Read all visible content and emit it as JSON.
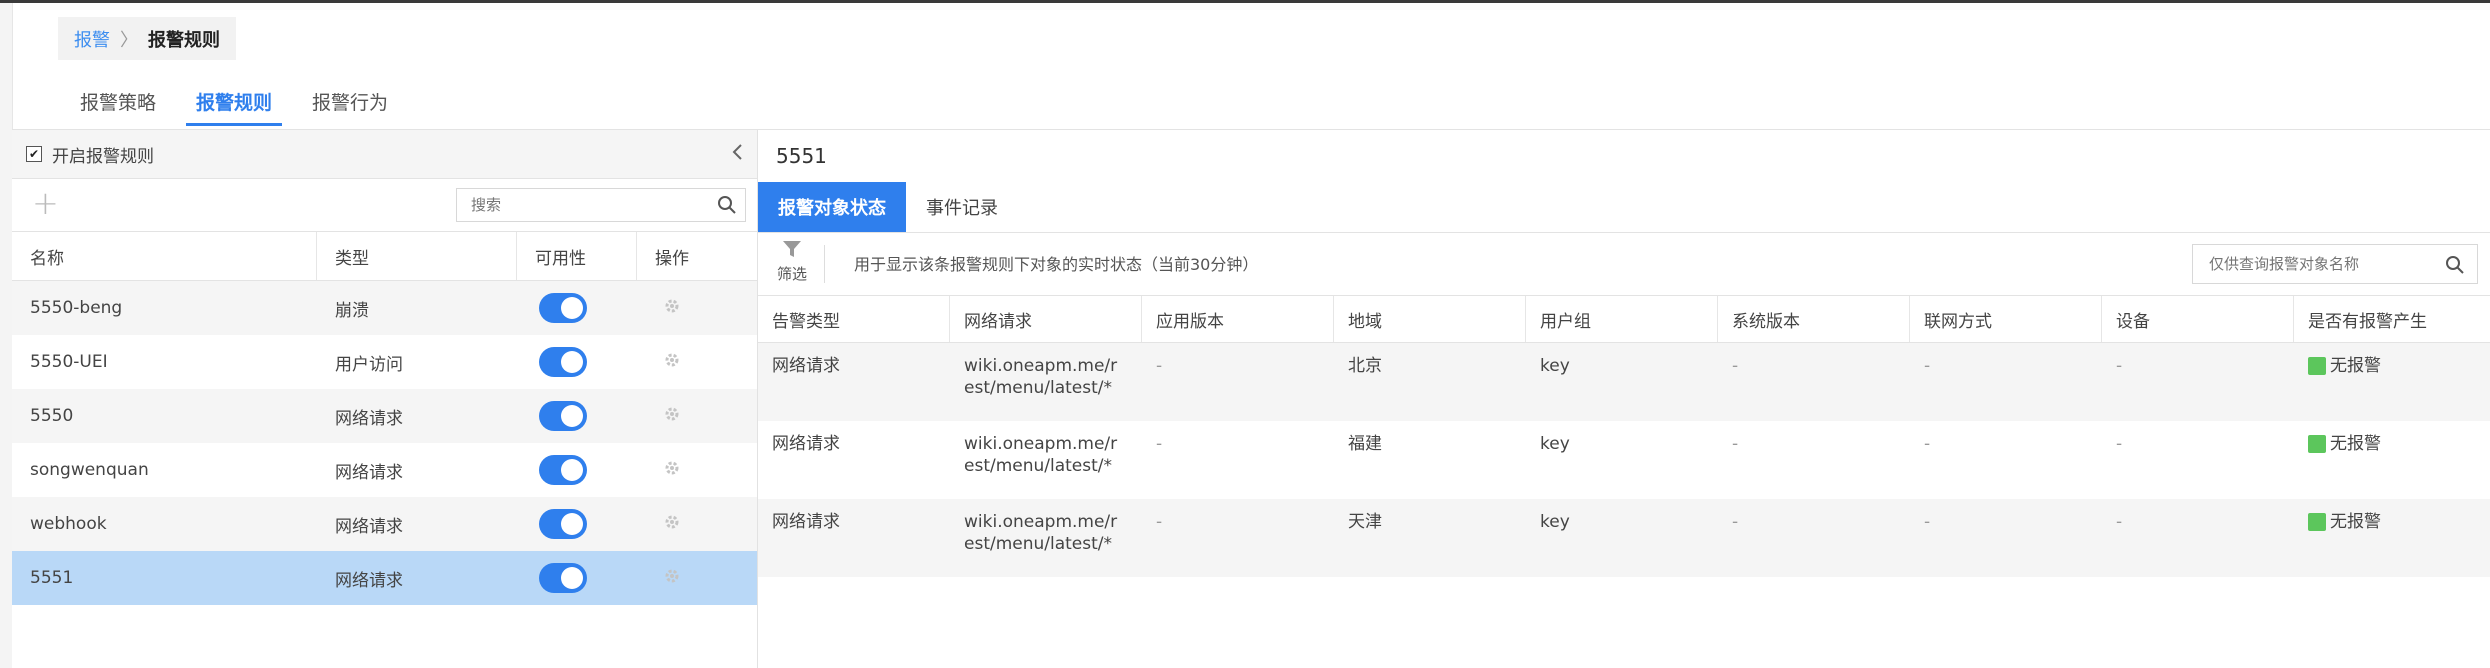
{
  "breadcrumb": {
    "parent": "报警",
    "separator": "〉",
    "current": "报警规则"
  },
  "top_tabs": [
    {
      "label": "报警策略",
      "active": false
    },
    {
      "label": "报警规则",
      "active": true
    },
    {
      "label": "报警行为",
      "active": false
    }
  ],
  "left_panel": {
    "enable_label": "开启报警规则",
    "enable_checked": true,
    "search_placeholder": "搜索",
    "columns": [
      "名称",
      "类型",
      "可用性",
      "操作"
    ],
    "rows": [
      {
        "name": "5550-beng",
        "type": "崩溃",
        "enabled": true
      },
      {
        "name": "5550-UEI",
        "type": "用户访问",
        "enabled": true
      },
      {
        "name": "5550",
        "type": "网络请求",
        "enabled": true
      },
      {
        "name": "songwenquan",
        "type": "网络请求",
        "enabled": true
      },
      {
        "name": "webhook",
        "type": "网络请求",
        "enabled": true
      },
      {
        "name": "5551",
        "type": "网络请求",
        "enabled": true,
        "selected": true
      }
    ]
  },
  "right_panel": {
    "title": "5551",
    "tabs": [
      {
        "label": "报警对象状态",
        "active": true
      },
      {
        "label": "事件记录",
        "active": false
      }
    ],
    "filter_label": "筛选",
    "filter_desc": "用于显示该条报警规则下对象的实时状态（当前30分钟）",
    "search_placeholder": "仅供查询报警对象名称",
    "columns": [
      "告警类型",
      "网络请求",
      "应用版本",
      "地域",
      "用户组",
      "系统版本",
      "联网方式",
      "设备",
      "是否有报警产生"
    ],
    "rows": [
      {
        "type": "网络请求",
        "url1": "wiki.oneapm.me/r",
        "url2": "est/menu/latest/*",
        "app_version": "-",
        "region": "北京",
        "user_group": "key",
        "os_version": "-",
        "network": "-",
        "device": "-",
        "alarm": "无报警"
      },
      {
        "type": "网络请求",
        "url1": "wiki.oneapm.me/r",
        "url2": "est/menu/latest/*",
        "app_version": "-",
        "region": "福建",
        "user_group": "key",
        "os_version": "-",
        "network": "-",
        "device": "-",
        "alarm": "无报警"
      },
      {
        "type": "网络请求",
        "url1": "wiki.oneapm.me/r",
        "url2": "est/menu/latest/*",
        "app_version": "-",
        "region": "天津",
        "user_group": "key",
        "os_version": "-",
        "network": "-",
        "device": "-",
        "alarm": "无报警"
      }
    ]
  },
  "colors": {
    "accent": "#2f7fed",
    "selected_row": "#b9d8f7",
    "ok_status": "#5cc65c"
  },
  "icons": [
    "chevron-left-icon",
    "plus-icon",
    "search-icon",
    "gear-icon",
    "filter-icon",
    "checkbox-icon"
  ]
}
